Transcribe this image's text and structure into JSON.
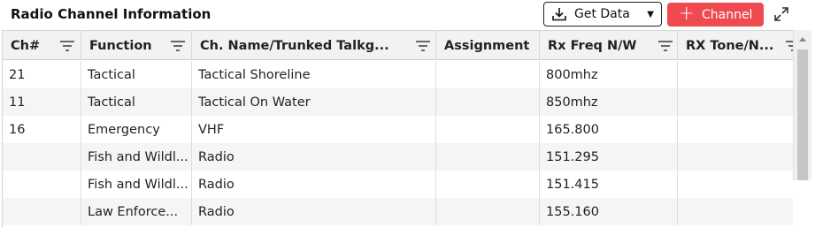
{
  "panel": {
    "title": "Radio Channel Information"
  },
  "toolbar": {
    "get_data_label": "Get Data",
    "add_channel_label": "Channel",
    "add_button_color": "#ee4a50"
  },
  "columns": [
    {
      "label": "Ch#",
      "filter_icon": "filter-icon"
    },
    {
      "label": "Function",
      "filter_icon": "filter-icon"
    },
    {
      "label": "Ch. Name/Trunked Talkg...",
      "filter_icon": "filter-icon"
    },
    {
      "label": "Assignment"
    },
    {
      "label": "Rx Freq N/W",
      "filter_icon": "filter-icon"
    },
    {
      "label": "RX Tone/N...",
      "filter_icon": "filter-icon"
    }
  ],
  "rows": [
    {
      "ch": "21",
      "function": "Tactical",
      "name": "Tactical Shoreline",
      "assignment": "",
      "rx_freq": "800mhz",
      "rx_tone": ""
    },
    {
      "ch": "11",
      "function": "Tactical",
      "name": "Tactical On Water",
      "assignment": "",
      "rx_freq": "850mhz",
      "rx_tone": ""
    },
    {
      "ch": "16",
      "function": "Emergency",
      "name": "VHF",
      "assignment": "",
      "rx_freq": "165.800",
      "rx_tone": ""
    },
    {
      "ch": "",
      "function": "Fish and Wildl...",
      "name": "Radio",
      "assignment": "",
      "rx_freq": "151.295",
      "rx_tone": ""
    },
    {
      "ch": "",
      "function": "Fish and Wildl...",
      "name": "Radio",
      "assignment": "",
      "rx_freq": "151.415",
      "rx_tone": ""
    },
    {
      "ch": "",
      "function": "Law Enforce...",
      "name": "Radio",
      "assignment": "",
      "rx_freq": "155.160",
      "rx_tone": ""
    }
  ]
}
